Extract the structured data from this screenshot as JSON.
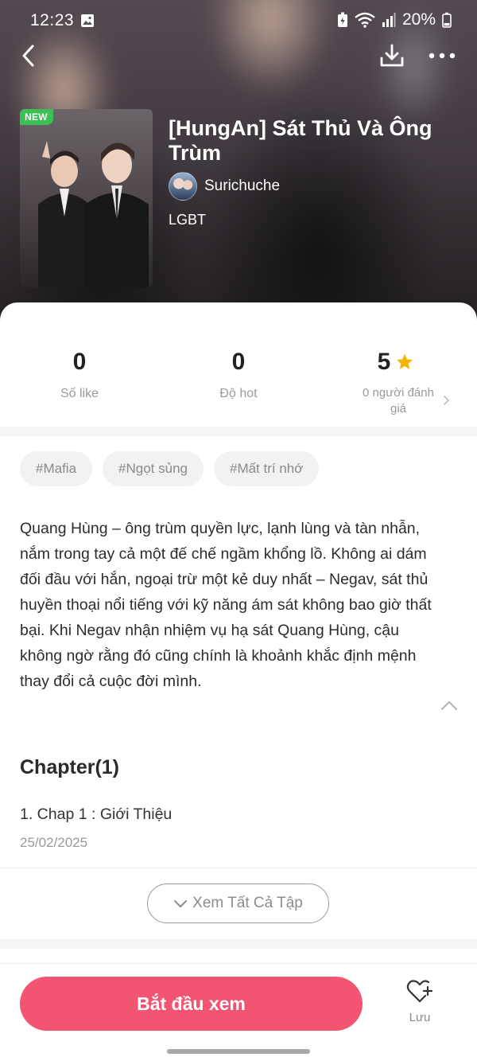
{
  "status_bar": {
    "time": "12:23",
    "battery_text": "20%"
  },
  "story": {
    "badge": "NEW",
    "title": "[HungAn] Sát Thủ Và Ông Trùm",
    "author": "Surichuche",
    "genre": "LGBT"
  },
  "stats": {
    "likes_value": "0",
    "likes_label": "Số like",
    "hot_value": "0",
    "hot_label": "Độ hot",
    "rating_value": "5",
    "rating_label": "0 người đánh giá"
  },
  "tags": [
    "#Mafia",
    "#Ngọt sủng",
    "#Mất trí nhớ"
  ],
  "synopsis": "Quang Hùng – ông trùm quyền lực, lạnh lùng và tàn nhẫn, nắm trong tay cả một đế chế ngầm khổng lồ. Không ai dám đối đầu với hắn, ngoại trừ một kẻ duy nhất – Negav, sát thủ huyền thoại nổi tiếng với kỹ năng ám sát không bao giờ thất bại. Khi Negav nhận nhiệm vụ hạ sát Quang Hùng, cậu không ngờ rằng đó cũng chính là khoảnh khắc định mệnh thay đổi cả cuộc đời mình.",
  "chapters": {
    "heading": "Chapter(1)",
    "items": [
      {
        "title": "1. Chap 1 : Giới Thiệu",
        "date": "25/02/2025"
      }
    ],
    "view_all_label": "Xem Tất Cả Tập"
  },
  "bottom": {
    "start_label": "Bắt đầu xem",
    "save_label": "Lưu"
  },
  "colors": {
    "accent": "#f25572",
    "badge_green": "#3cbf55",
    "star": "#f5b301"
  }
}
